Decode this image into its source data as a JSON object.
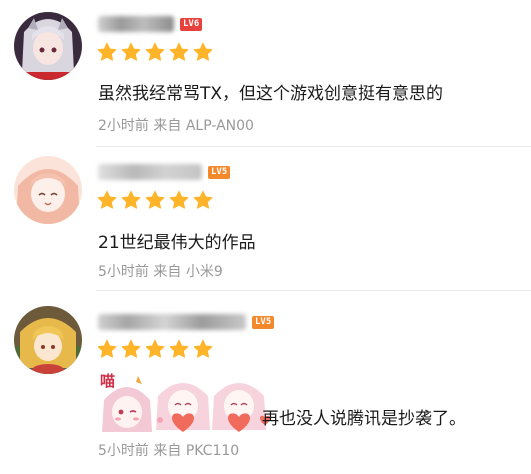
{
  "colors": {
    "star": "#ffb42a",
    "lv6": "#e8413c",
    "lv5": "#f3882c",
    "meta": "#999999"
  },
  "comments": [
    {
      "level": "LV6",
      "stars": 5,
      "text": "虽然我经常骂TX，但这个游戏创意挺有意思的",
      "time": "2小时前",
      "source_prefix": "来自",
      "device": "ALP-AN00"
    },
    {
      "level": "LV5",
      "stars": 5,
      "text": "21世纪最伟大的作品",
      "time": "5小时前",
      "source_prefix": "来自",
      "device": "小米9"
    },
    {
      "level": "LV5",
      "stars": 5,
      "sticker_text": "喵",
      "text": "再也没人说腾讯是抄袭了。",
      "time": "5小时前",
      "source_prefix": "来自",
      "device": "PKC110"
    }
  ]
}
